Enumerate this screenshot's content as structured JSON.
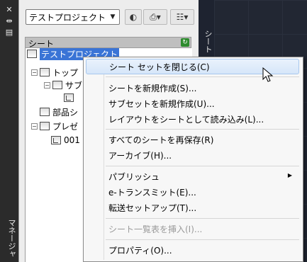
{
  "strip": {
    "close_icon": "close-icon",
    "pin_icon": "pin-icon",
    "menu_icon": "properties-icon",
    "vertical_title": "マネージャ"
  },
  "toolbar": {
    "combo_value": "テストプロジェクト"
  },
  "section": {
    "label": "シート"
  },
  "tree": {
    "items": [
      {
        "label": "テストプロジェクト",
        "level": 0
      },
      {
        "label": "トップ",
        "level": 1
      },
      {
        "label": "サブ",
        "level": 2
      },
      {
        "label": "",
        "level": 3
      },
      {
        "label": "部品シ",
        "level": 1
      },
      {
        "label": "プレゼ",
        "level": 1
      },
      {
        "label": "001",
        "level": 2
      }
    ]
  },
  "side_title": "シート一覧",
  "menu": {
    "items": [
      {
        "label": "シート セットを閉じる(C)",
        "state": "hover"
      },
      {
        "label": "シートを新規作成(S)..."
      },
      {
        "label": "サブセットを新規作成(U)..."
      },
      {
        "label": "レイアウトをシートとして読み込み(L)..."
      },
      {
        "label": "すべてのシートを再保存(R)"
      },
      {
        "label": "アーカイブ(H)..."
      },
      {
        "label": "パブリッシュ",
        "submenu": true
      },
      {
        "label": "e-トランスミット(E)..."
      },
      {
        "label": "転送セットアップ(T)..."
      },
      {
        "label": "シート一覧表を挿入(I)...",
        "state": "disabled"
      },
      {
        "label": "プロパティ(O)..."
      }
    ]
  }
}
